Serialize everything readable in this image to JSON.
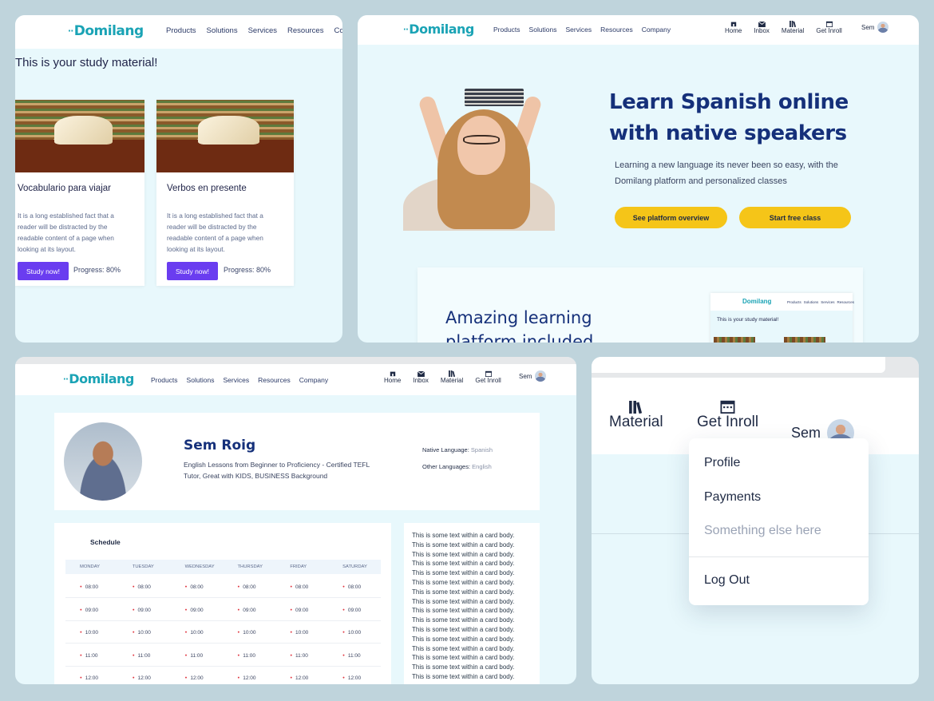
{
  "brand": {
    "logo": "Domilang",
    "accent": "#1aa3b5",
    "primary": "#15307a",
    "purple": "#6a3df0",
    "yellow": "#f5c518"
  },
  "nav": {
    "links": [
      "Products",
      "Solutions",
      "Services",
      "Resources",
      "Company"
    ],
    "links_p1": [
      "Products",
      "Solutions",
      "Services",
      "Resources",
      "Comp"
    ],
    "icons": [
      {
        "label": "Home",
        "icon": "home-icon"
      },
      {
        "label": "Inbox",
        "icon": "inbox-icon"
      },
      {
        "label": "Material",
        "icon": "books-icon"
      },
      {
        "label": "Get Inroll",
        "icon": "calendar-icon"
      }
    ],
    "user": "Sem"
  },
  "study": {
    "title": "This is your study material!",
    "cards": [
      {
        "title": "Vocabulario para viajar",
        "text": "It is a long established fact that a reader will be distracted by the readable content of a page when looking at its layout.",
        "button": "Study now!",
        "progress": "Progress: 80%"
      },
      {
        "title": "Verbos en presente",
        "text": "It is a long established fact that a reader will be distracted by the readable content of a page when looking at its layout.",
        "button": "Study now!",
        "progress": "Progress: 80%"
      }
    ]
  },
  "landing": {
    "hero_title": "Learn Spanish online with native speakers",
    "hero_sub": "Learning a new language its never been so easy, with the Domilang platform and personalized classes",
    "btn_overview": "See platform overview",
    "btn_free": "Start free class",
    "promo_title": "Amazing learning platform included",
    "mini_title": "This is your study material!"
  },
  "profile": {
    "name": "Sem Roig",
    "bio": "English Lessons from Beginner to Proficiency - Certified TEFL Tutor, Great with KIDS, BUSINESS Background",
    "native_label": "Native Language:",
    "native_value": "Spanish",
    "other_label": "Other Languages:",
    "other_value": "English"
  },
  "schedule": {
    "title": "Schedule",
    "days": [
      "MONDAY",
      "TUESDAY",
      "WEDNESDAY",
      "THURSDAY",
      "FRIDAY",
      "SATURDAY"
    ],
    "times": [
      "08:00",
      "09:00",
      "10:00",
      "11:00",
      "12:00"
    ]
  },
  "card_body": {
    "line": "This is some text within a card body.",
    "repeat": 16
  },
  "dropdown": {
    "items": [
      "Profile",
      "Payments",
      "Something else here"
    ],
    "logout": "Log Out"
  }
}
